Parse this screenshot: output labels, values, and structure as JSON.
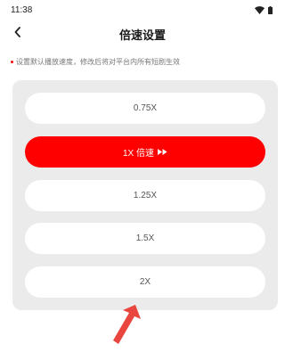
{
  "status_bar": {
    "time": "11:38",
    "icons": [
      "wifi-icon",
      "battery-icon"
    ]
  },
  "header": {
    "back_icon": "chevron-left-icon",
    "title": "倍速设置"
  },
  "hint": {
    "text": "设置默认播放速度，修改后将对平台内所有短剧生效"
  },
  "speed_options": [
    {
      "label": "0.75X",
      "selected": false
    },
    {
      "label": "1X 倍速",
      "selected": true,
      "icon": "fast-forward-icon"
    },
    {
      "label": "1.25X",
      "selected": false
    },
    {
      "label": "1.5X",
      "selected": false
    },
    {
      "label": "2X",
      "selected": false
    }
  ],
  "colors": {
    "accent": "#ff0000",
    "panel_bg": "#ebebeb",
    "arrow": "#e8463f"
  }
}
